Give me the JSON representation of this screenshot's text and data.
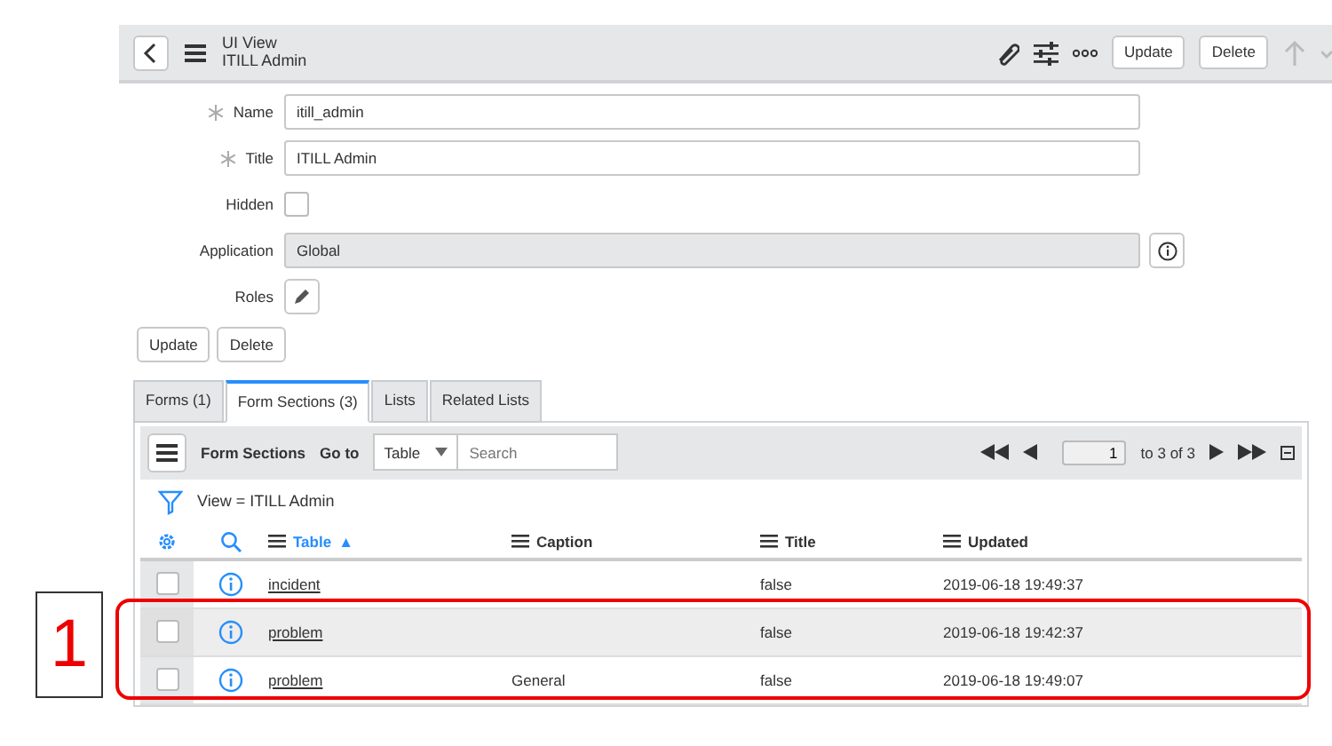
{
  "header": {
    "title": "UI View",
    "subtitle": "ITILL Admin",
    "buttons": [
      "Update",
      "Delete"
    ]
  },
  "fields": [
    {
      "kind": "text",
      "label": "Name",
      "required": true,
      "value": "itill_admin",
      "readonly": false
    },
    {
      "kind": "text",
      "label": "Title",
      "required": true,
      "value": "ITILL Admin",
      "readonly": false
    },
    {
      "kind": "checkbox",
      "label": "Hidden",
      "checked": false
    },
    {
      "kind": "text",
      "label": "Application",
      "required": false,
      "value": "Global",
      "readonly": true
    },
    {
      "kind": "roles",
      "label": "Roles"
    }
  ],
  "form_buttons": [
    "Update",
    "Delete"
  ],
  "tabs": [
    {
      "label": "Forms (1)",
      "selected": false
    },
    {
      "label": "Form Sections (3)",
      "selected": true
    },
    {
      "label": "Lists",
      "selected": false
    },
    {
      "label": "Related Lists",
      "selected": false
    }
  ],
  "list": {
    "title": "Form Sections",
    "goto_label": "Go to",
    "goto_value": "Table",
    "search_placeholder": "Search",
    "page": "1",
    "page_info": "to 3 of 3",
    "filter": "View = ITILL Admin",
    "columns": [
      {
        "label": "Table",
        "sorted": true,
        "sort_mark": "▲"
      },
      {
        "label": "Caption",
        "sorted": false
      },
      {
        "label": "Title",
        "sorted": false
      },
      {
        "label": "Updated",
        "sorted": false
      }
    ],
    "rows": [
      {
        "table": "incident",
        "caption": "",
        "title": "false",
        "updated": "2019-06-18 19:49:37",
        "highlighted": false,
        "checked": false
      },
      {
        "table": "problem",
        "caption": "",
        "title": "false",
        "updated": "2019-06-18 19:42:37",
        "highlighted": true,
        "checked": false
      },
      {
        "table": "problem",
        "caption": "General",
        "title": "false",
        "updated": "2019-06-18 19:49:07",
        "highlighted": false,
        "checked": false
      }
    ]
  },
  "annotation": {
    "label": "1"
  }
}
